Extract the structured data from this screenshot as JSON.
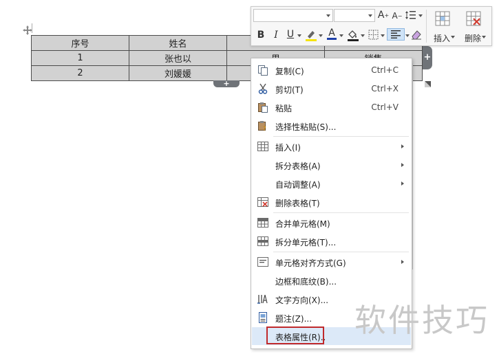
{
  "document": {
    "table": {
      "rows": [
        [
          "序号",
          "姓名",
          "",
          ""
        ],
        [
          "1",
          "张也以",
          "男",
          "销售"
        ],
        [
          "2",
          "刘媛媛",
          "",
          ""
        ]
      ]
    },
    "add_column": "+",
    "add_row": "+"
  },
  "toolbar": {
    "grow_font": "A",
    "shrink_font": "A",
    "bold": "B",
    "italic": "I",
    "underline": "U",
    "font_color": "A",
    "insert_label": "插入",
    "delete_label": "删除"
  },
  "context_menu": {
    "items": [
      {
        "label": "复制(C)",
        "shortcut": "Ctrl+C"
      },
      {
        "label": "剪切(T)",
        "shortcut": "Ctrl+X"
      },
      {
        "label": "粘贴",
        "shortcut": "Ctrl+V"
      },
      {
        "label": "选择性粘贴(S)..."
      },
      {
        "label": "插入(I)"
      },
      {
        "label": "拆分表格(A)"
      },
      {
        "label": "自动调整(A)"
      },
      {
        "label": "删除表格(T)"
      },
      {
        "label": "合并单元格(M)"
      },
      {
        "label": "拆分单元格(T)..."
      },
      {
        "label": "单元格对齐方式(G)"
      },
      {
        "label": "边框和底纹(B)..."
      },
      {
        "label": "文字方向(X)..."
      },
      {
        "label": "题注(Z)..."
      },
      {
        "label": "表格属性(R).."
      }
    ]
  },
  "watermark": "软件技巧",
  "colors": {
    "highlight": "#c0282a",
    "hover": "#dce9f8"
  }
}
